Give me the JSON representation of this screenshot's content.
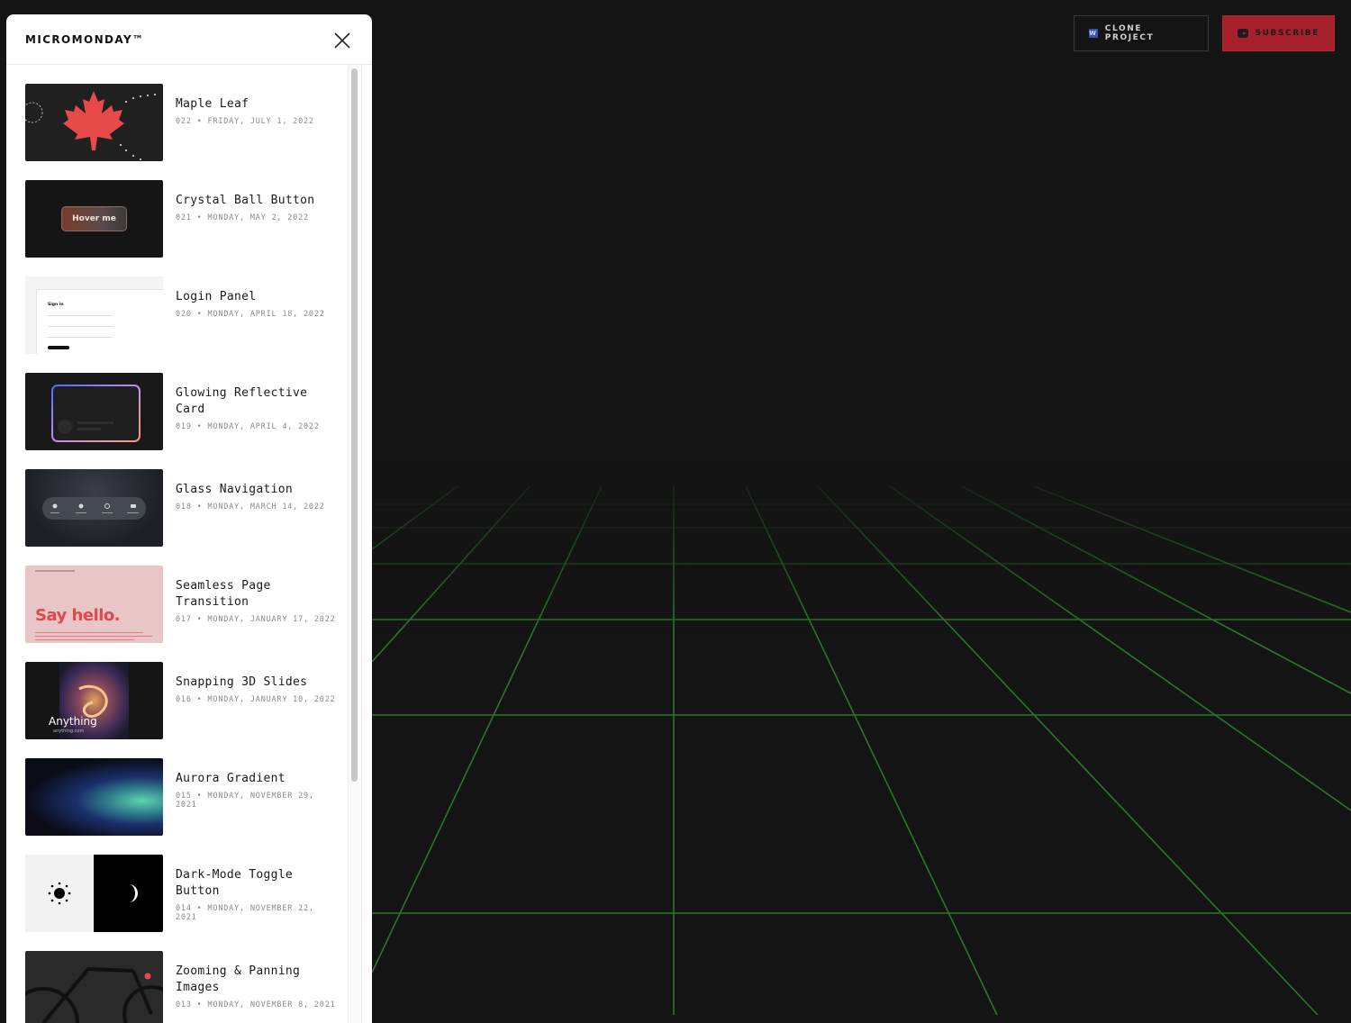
{
  "app": {
    "brand": "MICROMONDAY™"
  },
  "header_actions": {
    "clone_label": "CLONE PROJECT",
    "subscribe_label": "SUBSCRIBE"
  },
  "thumbnail_text": {
    "crystal_button": "Hover me",
    "login_heading": "Sign in",
    "say_hello": "Say hello.",
    "snapping_caption": "Anything",
    "snapping_subcaption": "anything.com"
  },
  "items": [
    {
      "title": "Maple Leaf",
      "meta": "022 • FRIDAY, JULY 1, 2022"
    },
    {
      "title": "Crystal Ball Button",
      "meta": "021 • MONDAY, MAY 2, 2022"
    },
    {
      "title": "Login Panel",
      "meta": "020 • MONDAY, APRIL 18, 2022"
    },
    {
      "title": "Glowing Reflective Card",
      "meta": "019 • MONDAY, APRIL 4, 2022"
    },
    {
      "title": "Glass Navigation",
      "meta": "018 • MONDAY, MARCH 14, 2022"
    },
    {
      "title": "Seamless Page Transition",
      "meta": "017 • MONDAY, JANUARY 17, 2022"
    },
    {
      "title": "Snapping 3D Slides",
      "meta": "016 • MONDAY, JANUARY 10, 2022"
    },
    {
      "title": "Aurora Gradient",
      "meta": "015 • MONDAY, NOVEMBER 29, 2021"
    },
    {
      "title": "Dark-Mode Toggle Button",
      "meta": "014 • MONDAY, NOVEMBER 22, 2021"
    },
    {
      "title": "Zooming & Panning Images",
      "meta": "013 • MONDAY, NOVEMBER 8, 2021"
    }
  ],
  "colors": {
    "grid_line": "#2f8a2f",
    "subscribe_bg": "#a5202a",
    "accent_red": "#e0484b"
  }
}
